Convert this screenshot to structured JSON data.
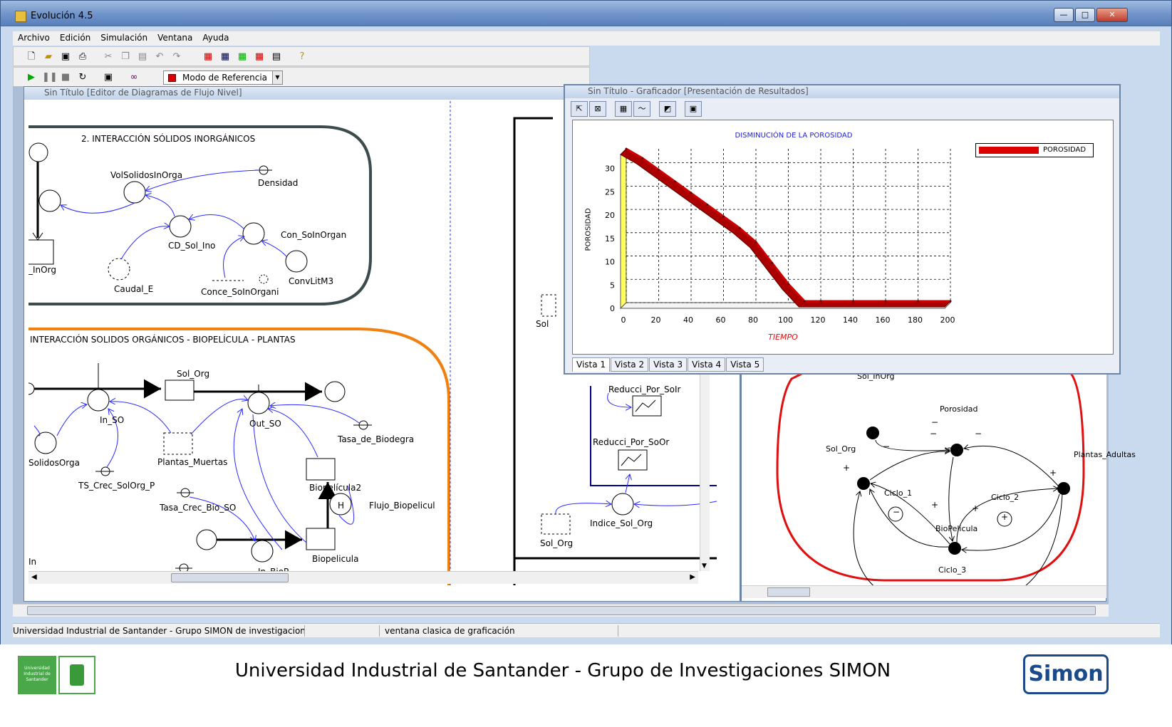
{
  "window": {
    "title": "Evolución 4.5"
  },
  "menu": [
    "Archivo",
    "Edición",
    "Simulación",
    "Ventana",
    "Ayuda"
  ],
  "toolbar": {
    "mode_label": "Modo de Referencia"
  },
  "editor": {
    "title": "Sin Título [Editor de Diagramas de Flujo Nivel]",
    "section1_title": "2. INTERACCIÓN SÓLIDOS INORGÁNICOS",
    "section2_title": "INTERACCIÓN SOLIDOS ORGÁNICOS - BIOPELÍCULA - PLANTAS",
    "labels": {
      "vol_solidos": "VolSolidosInOrga",
      "densidad": "Densidad",
      "con_soin": "Con_SoInOrgan",
      "cd_sol_ino": "CD_Sol_Ino",
      "convlitm3": "ConvLitM3",
      "inorg": "_InOrg",
      "caudal_e": "Caudal_E",
      "conce": "Conce_SoInOrgani",
      "sol_org": "Sol_Org",
      "in_so": "In_SO",
      "out_so": "Out_SO",
      "tasa_biodeg": "Tasa_de_Biodegra",
      "solidos_orga": "SolidosOrga",
      "plantas_muertas": "Plantas_Muertas",
      "ts_crec": "TS_Crec_SolOrg_P",
      "biopelicula2": "Biopelícula2",
      "flujo_bio": "Flujo_Biopelicul",
      "tasa_crec_bio": "Tasa_Crec_Bio_SO",
      "biopelicula": "Biopelicula",
      "in_biop": "In_BioP",
      "in": "In",
      "hash": "H"
    }
  },
  "middle": {
    "reducci_soin": "Reducci_Por_SoIr",
    "reducci_soor": "Reducci_Por_SoOr",
    "indice": "Indice_Sol_Org",
    "sol_org": "Sol_Org",
    "sol": "Sol"
  },
  "causal": {
    "sol_inorg": "Sol_InOrg",
    "porosidad": "Porosidad",
    "sol_org": "Sol_Org",
    "plantas_adultas": "Plantas_Adultas",
    "biopelicula": "BioPelicula",
    "ciclo1": "Ciclo_1",
    "ciclo2": "Ciclo_2",
    "ciclo3": "Ciclo_3",
    "minus": "−",
    "plus": "+"
  },
  "grapher": {
    "title": "Sin Título - Graficador [Presentación de Resultados]",
    "tabs": [
      "Vista 1",
      "Vista 2",
      "Vista 3",
      "Vista 4",
      "Vista 5"
    ]
  },
  "chart_data": {
    "type": "line",
    "title": "DISMINUCIÓN DE LA POROSIDAD",
    "xlabel": "TIEMPO",
    "ylabel": "POROSIDAD",
    "xlim": [
      0,
      200
    ],
    "ylim": [
      0,
      30
    ],
    "x_ticks": [
      0,
      20,
      40,
      60,
      80,
      100,
      120,
      140,
      160,
      180,
      200
    ],
    "y_ticks": [
      0,
      5,
      10,
      15,
      20,
      25,
      30
    ],
    "grid": true,
    "legend_position": "top-right",
    "series": [
      {
        "name": "POROSIDAD",
        "color": "#cc0000",
        "x": [
          0,
          10,
          20,
          30,
          40,
          50,
          60,
          70,
          80,
          90,
          100,
          110,
          120,
          140,
          160,
          180,
          200
        ],
        "y": [
          33,
          31,
          28.5,
          26,
          23.5,
          21,
          18.5,
          16,
          13,
          8.5,
          4,
          0.3,
          0.3,
          0.3,
          0.3,
          0.3,
          0.3
        ]
      }
    ]
  },
  "status": {
    "left": "Universidad Industrial de Santander - Grupo SIMON de investigaciones [",
    "mid": "ventana clasica de graficación"
  },
  "footer": {
    "text": "Universidad Industrial de Santander - Grupo de Investigaciones SIMON",
    "logo_left_text": "Universidad Industrial de Santander",
    "logo_right_text": "Simon"
  }
}
